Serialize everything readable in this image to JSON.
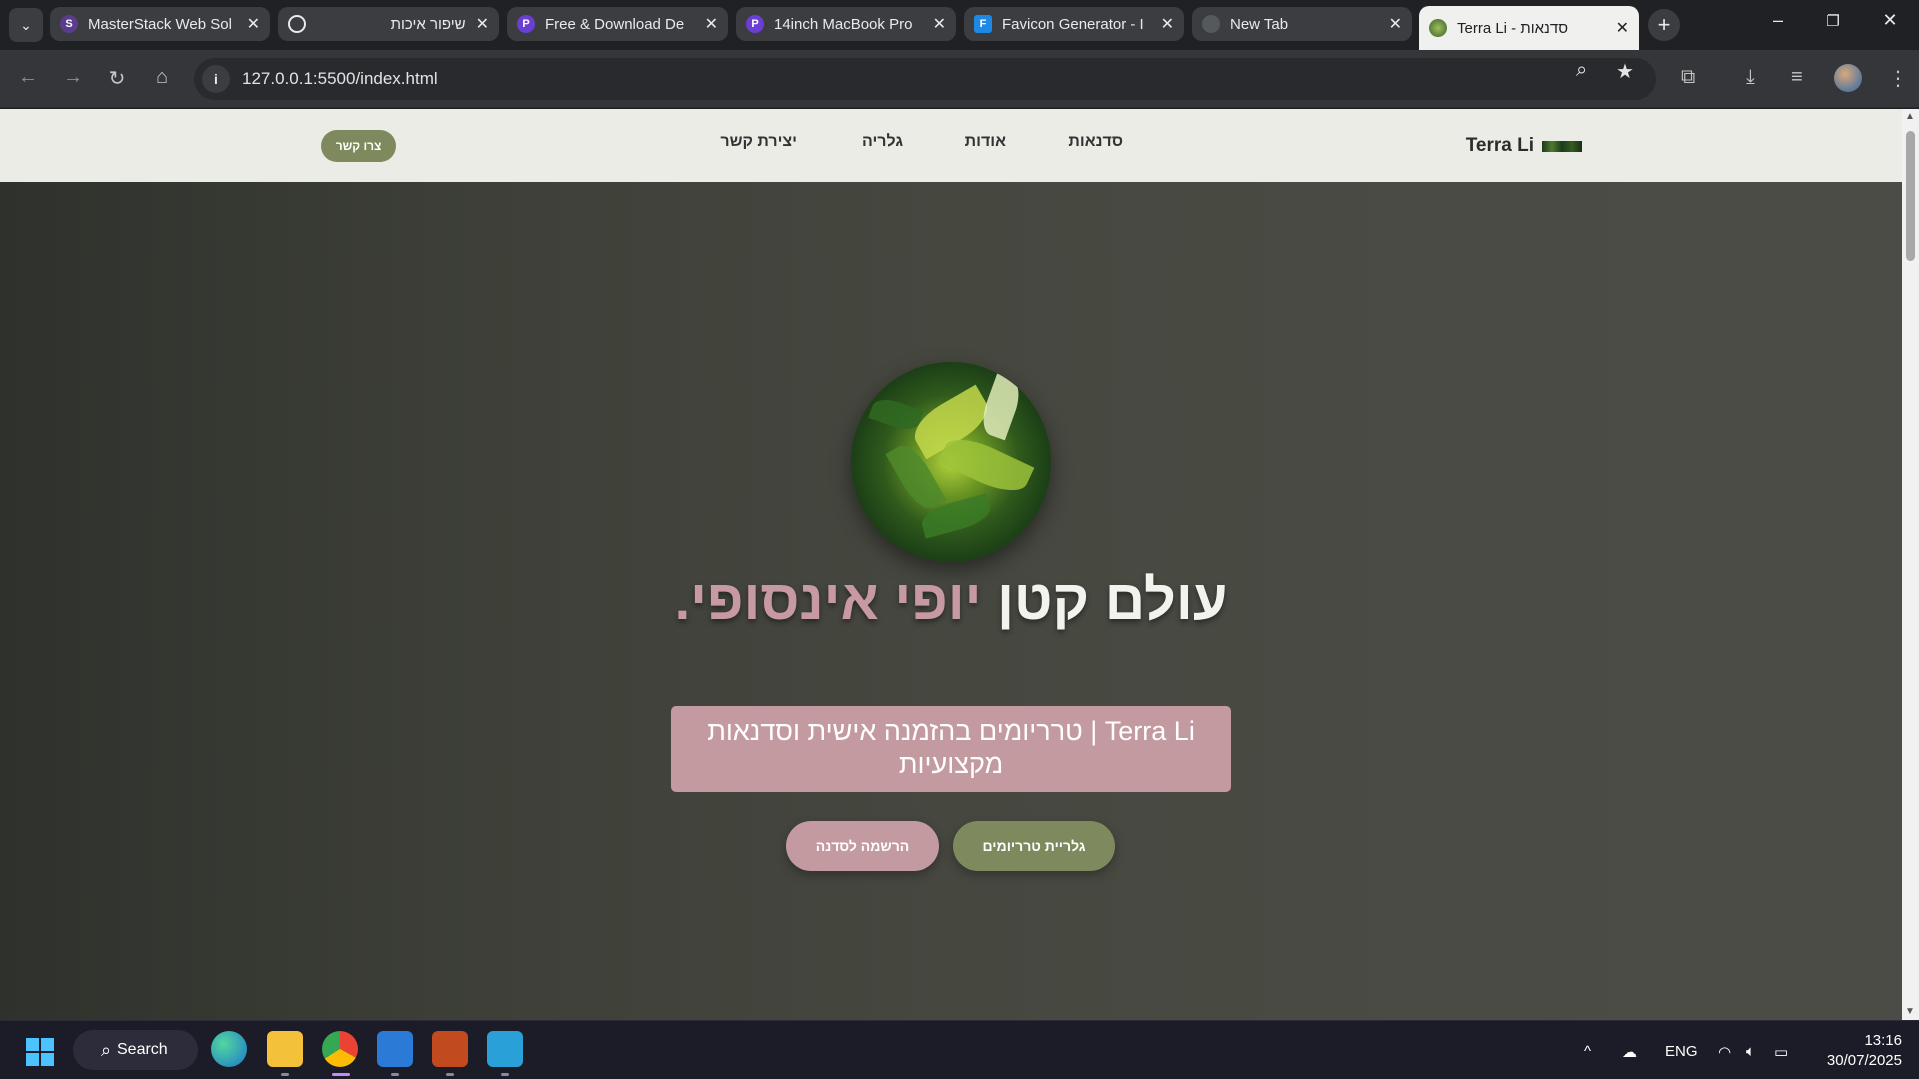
{
  "browser": {
    "tabs": [
      {
        "title": "MasterStack Web Sol",
        "icon": "masterstack-favicon",
        "active": false
      },
      {
        "title": "שיפור איכות",
        "icon": "chatgpt-favicon",
        "active": false
      },
      {
        "title": "Free & Download De",
        "icon": "pixelcave-favicon",
        "active": false
      },
      {
        "title": "14inch MacBook Pro",
        "icon": "pixelcave-favicon",
        "active": false
      },
      {
        "title": "Favicon Generator - I",
        "icon": "favicon-generator-favicon",
        "active": false
      },
      {
        "title": "New Tab",
        "icon": "chrome-favicon",
        "active": false
      },
      {
        "title": "Terra Li - סדנאות",
        "icon": "terra-li-favicon",
        "active": true
      }
    ],
    "address": "127.0.0.1:5500/index.html"
  },
  "site": {
    "brand": "Terra Li",
    "nav": {
      "workshops": "סדנאות",
      "about": "אודות",
      "gallery": "גלריה",
      "contact": "יצירת קשר"
    },
    "contact_button": "צרו קשר",
    "hero": {
      "title_main": "עולם קטן ",
      "title_accent": "יופי אינסופי.",
      "subtitle": "Terra Li | טרריומים בהזמנה אישית וסדנאות מקצועיות",
      "btn_gallery": "גלריית טרריומים",
      "btn_signup": "הרשמה לסדנה"
    },
    "colors": {
      "nav_bg": "#ebece6",
      "olive": "#7e8a5e",
      "pink": "#c49aa1"
    }
  },
  "taskbar": {
    "search": "Search",
    "lang": "ENG",
    "time": "13:16",
    "date": "30/07/2025"
  }
}
